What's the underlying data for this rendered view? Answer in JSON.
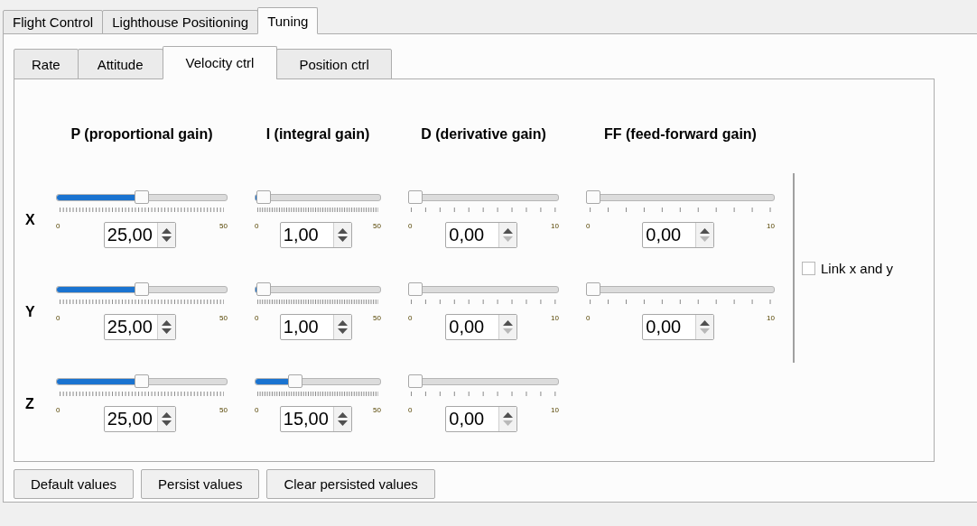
{
  "main_tabs": [
    {
      "label": "Flight Control",
      "selected": false
    },
    {
      "label": "Lighthouse Positioning",
      "selected": false
    },
    {
      "label": "Tuning",
      "selected": true
    }
  ],
  "sub_tabs": [
    {
      "label": "Rate",
      "selected": false
    },
    {
      "label": "Attitude",
      "selected": false
    },
    {
      "label": "Velocity ctrl",
      "selected": true
    },
    {
      "label": "Position ctrl",
      "selected": false
    }
  ],
  "columns": [
    "P (proportional gain)",
    "I (integral gain)",
    "D (derivative gain)",
    "FF (feed-forward gain)"
  ],
  "rows": [
    {
      "label": "X",
      "cells": [
        {
          "kind": "fine",
          "level": 0.5,
          "min": "0",
          "max": "50",
          "value": "25,00",
          "down_disabled": false
        },
        {
          "kind": "fine",
          "level": 0.02,
          "min": "0",
          "max": "50",
          "value": "1,00",
          "down_disabled": false
        },
        {
          "kind": "coarse",
          "level": 0,
          "min": "0",
          "max": "10",
          "value": "0,00",
          "down_disabled": true
        },
        {
          "kind": "coarse",
          "level": 0,
          "min": "0",
          "max": "10",
          "value": "0,00",
          "down_disabled": true
        }
      ]
    },
    {
      "label": "Y",
      "cells": [
        {
          "kind": "fine",
          "level": 0.5,
          "min": "0",
          "max": "50",
          "value": "25,00",
          "down_disabled": false
        },
        {
          "kind": "fine",
          "level": 0.02,
          "min": "0",
          "max": "50",
          "value": "1,00",
          "down_disabled": false
        },
        {
          "kind": "coarse",
          "level": 0,
          "min": "0",
          "max": "10",
          "value": "0,00",
          "down_disabled": true
        },
        {
          "kind": "coarse",
          "level": 0,
          "min": "0",
          "max": "10",
          "value": "0,00",
          "down_disabled": true
        }
      ]
    },
    {
      "label": "Z",
      "cells": [
        {
          "kind": "fine",
          "level": 0.5,
          "min": "0",
          "max": "50",
          "value": "25,00",
          "down_disabled": false
        },
        {
          "kind": "fine",
          "level": 0.3,
          "min": "0",
          "max": "50",
          "value": "15,00",
          "down_disabled": false
        },
        {
          "kind": "coarse",
          "level": 0,
          "min": "0",
          "max": "10",
          "value": "0,00",
          "down_disabled": true
        }
      ]
    }
  ],
  "link_xy": {
    "label": "Link x and y",
    "checked": false
  },
  "buttons": [
    "Default values",
    "Persist values",
    "Clear persisted values"
  ]
}
